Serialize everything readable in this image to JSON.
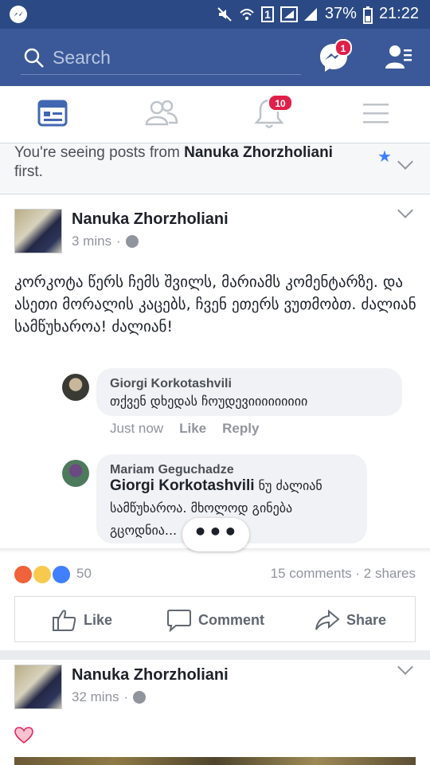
{
  "status_bar": {
    "battery": "37%",
    "time": "21:22",
    "sim_label": "1"
  },
  "header": {
    "search_placeholder": "Search",
    "messenger_badge": "1"
  },
  "tabs": {
    "notifications_badge": "10"
  },
  "see_first": {
    "prefix": "You're seeing posts from ",
    "name": "Nanuka Zhorzholiani",
    "suffix": "first."
  },
  "post1": {
    "author": "Nanuka Zhorzholiani",
    "time": "3 mins",
    "separator": "·",
    "text": "კორკოტა წერს ჩემს შვილს, მარიამს კომენტარზე. და ასეთი მორალის კაცებს, ჩვენ ეთერს ვუთმობთ. ძალიან სამწუხაროა! ძალიან!",
    "comments": [
      {
        "author": "Giorgi Korkotashvili",
        "text": "თქვენ დხედას ჩოუდევიიიიიიიიი",
        "time": "Just now",
        "like": "Like",
        "reply": "Reply"
      },
      {
        "author": "Mariam Geguchadze",
        "mention": "Giorgi Korkotashvili",
        "text": " ნუ ძალიან სამწუხაროა. მხოლოდ გინება გცოდნია..."
      }
    ],
    "more_label": "•••",
    "reaction_count": "50",
    "comments_count": "15 comments",
    "shares_count": "2 shares",
    "actions": {
      "like": "Like",
      "comment": "Comment",
      "share": "Share"
    }
  },
  "post2": {
    "author": "Nanuka Zhorzholiani",
    "time": "32 mins",
    "separator": "·"
  },
  "colors": {
    "brand": "#3b5998",
    "statusbar": "#2b4a85",
    "badge": "#e0204a",
    "link": "#4080ff"
  }
}
